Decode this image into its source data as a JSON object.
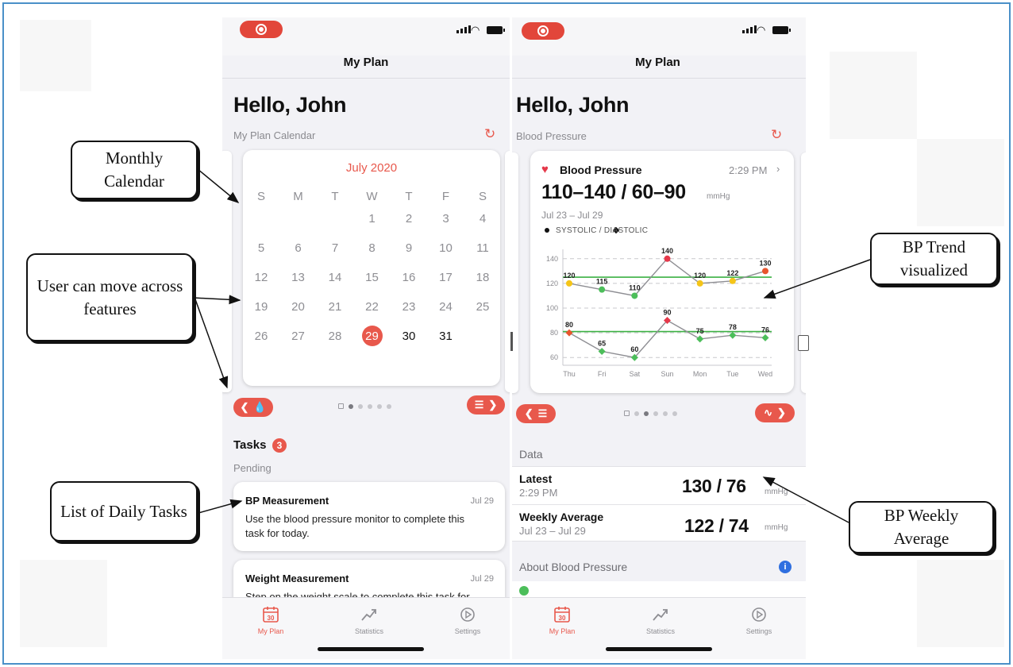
{
  "left_phone": {
    "nav_title": "My Plan",
    "greeting": "Hello, John",
    "section_label": "My Plan Calendar",
    "calendar": {
      "month": "July 2020",
      "weekdays": [
        "S",
        "M",
        "T",
        "W",
        "T",
        "F",
        "S"
      ],
      "weeks": [
        [
          "",
          "",
          "",
          "1",
          "2",
          "3",
          "4"
        ],
        [
          "5",
          "6",
          "7",
          "8",
          "9",
          "10",
          "11"
        ],
        [
          "12",
          "13",
          "14",
          "15",
          "16",
          "17",
          "18"
        ],
        [
          "19",
          "20",
          "21",
          "22",
          "23",
          "24",
          "25"
        ],
        [
          "26",
          "27",
          "28",
          "29",
          "30",
          "31",
          ""
        ]
      ],
      "today": "29"
    },
    "tasks_title": "Tasks",
    "tasks_count": "3",
    "pending_label": "Pending",
    "tasks": [
      {
        "title": "BP Measurement",
        "date": "Jul 29",
        "desc_line1": "Use the blood pressure monitor to complete this",
        "desc_line2": "task for today."
      },
      {
        "title": "Weight Measurement",
        "date": "Jul 29",
        "desc_line1": "Step on the weight scale to complete this task for",
        "desc_line2": ""
      }
    ]
  },
  "right_phone": {
    "nav_title": "My Plan",
    "greeting": "Hello, John",
    "section_label": "Blood Pressure",
    "bp_card": {
      "title": "Blood Pressure",
      "time": "2:29 PM",
      "value": "110–140 / 60–90",
      "unit": "mmHg",
      "date_range": "Jul 23 – Jul 29",
      "legend": "SYSTOLIC  /  DIASTOLIC"
    },
    "data_section_label": "Data",
    "data_rows": [
      {
        "name": "Latest",
        "sub": "2:29 PM",
        "value": "130 / 76",
        "unit": "mmHg"
      },
      {
        "name": "Weekly Average",
        "sub": "Jul 23 – Jul 29",
        "value": "122 / 74",
        "unit": "mmHg"
      }
    ],
    "about_label": "About Blood Pressure"
  },
  "chart_data": {
    "type": "line",
    "x": [
      "Thu",
      "Fri",
      "Sat",
      "Sun",
      "Mon",
      "Tue",
      "Wed"
    ],
    "series": [
      {
        "name": "SYSTOLIC",
        "values": [
          120,
          115,
          110,
          140,
          120,
          122,
          130
        ],
        "point_colors": [
          "#f5c518",
          "#4cbe5a",
          "#4cbe5a",
          "#e5384a",
          "#f5c518",
          "#f5c518",
          "#e8552d"
        ]
      },
      {
        "name": "DIASTOLIC",
        "values": [
          80,
          65,
          60,
          90,
          75,
          78,
          76
        ],
        "point_colors": [
          "#e8552d",
          "#4cbe5a",
          "#4cbe5a",
          "#e5384a",
          "#4cbe5a",
          "#4cbe5a",
          "#4cbe5a"
        ]
      }
    ],
    "y_ticks": [
      60,
      80,
      100,
      120,
      140
    ],
    "ylim": [
      55,
      145
    ],
    "reference_lines": [
      125,
      81
    ],
    "grid": "dashed horizontal"
  },
  "tabbar": {
    "tabs": [
      "My Plan",
      "Statistics",
      "Settings"
    ],
    "calendar_day": "30"
  },
  "callouts": {
    "monthly_calendar": "Monthly Calendar",
    "move_features": "User can move across features",
    "daily_tasks": "List of Daily Tasks",
    "bp_trend": "BP Trend visualized",
    "bp_weekly": "BP Weekly Average"
  },
  "colors": {
    "accent": "#e8584c",
    "heart": "#e5384a",
    "reference_line": "#3cb043",
    "frame_border": "#4a90c8"
  }
}
